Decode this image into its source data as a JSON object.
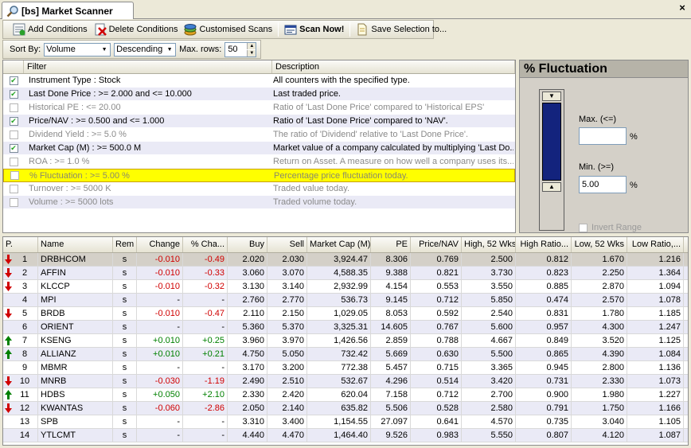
{
  "tab": {
    "title": "[bs] Market Scanner",
    "close": "×"
  },
  "toolbar": {
    "add": "Add Conditions",
    "delete": "Delete Conditions",
    "customised": "Customised Scans",
    "scan": "Scan Now!",
    "save": "Save Selection to..."
  },
  "sortbar": {
    "sort_label": "Sort By:",
    "sort_value": "Volume",
    "order_value": "Descending",
    "maxrows_label": "Max. rows:",
    "maxrows_value": "50"
  },
  "filters": {
    "headers": [
      "Filter",
      "Description"
    ],
    "rows": [
      {
        "checked": true,
        "name": "Instrument Type : Stock",
        "desc": "All counters with the specified type."
      },
      {
        "checked": true,
        "name": "Last Done Price :  >= 2.000  and <= 10.000",
        "desc": "Last traded price."
      },
      {
        "checked": false,
        "name": "Historical PE :  <= 20.00",
        "desc": "Ratio of 'Last Done Price' compared to 'Historical EPS'"
      },
      {
        "checked": true,
        "name": "Price/NAV :  >= 0.500  and <= 1.000",
        "desc": "Ratio of 'Last Done Price' compared to 'NAV'."
      },
      {
        "checked": false,
        "name": "Dividend Yield :  >= 5.0 %",
        "desc": "The ratio of 'Dividend' relative to 'Last Done Price'."
      },
      {
        "checked": true,
        "name": "Market Cap (M) :  >= 500.0 M",
        "desc": "Market value of a company calculated by multiplying 'Last Do..."
      },
      {
        "checked": false,
        "name": "ROA :  >= 1.0 %",
        "desc": "Return on Asset. A measure on how well a company uses its..."
      },
      {
        "checked": false,
        "name": "% Fluctuation :  >= 5.00 %",
        "desc": "Percentage price fluctuation today."
      },
      {
        "checked": false,
        "name": "Turnover :  >= 5000 K",
        "desc": "Traded value today."
      },
      {
        "checked": false,
        "name": "Volume :  >= 5000 lots",
        "desc": "Traded volume today."
      }
    ]
  },
  "fluct_panel": {
    "title": "% Fluctuation",
    "max_label": "Max. (<=)",
    "max_value": "",
    "min_label": "Min. (>=)",
    "min_value": "5.00",
    "unit": "%",
    "invert_label": "Invert Range"
  },
  "grid": {
    "headers": [
      "P.",
      "Name",
      "Rem",
      "Change",
      "% Cha...",
      "Buy",
      "Sell",
      "Market Cap (M)",
      "PE",
      "Price/NAV",
      "High, 52 Wks",
      "High Ratio...",
      "Low, 52 Wks",
      "Low Ratio,..."
    ],
    "rows": [
      {
        "dir": "down",
        "p": "1",
        "name": "DRBHCOM",
        "rem": "s",
        "chg": "-0.010",
        "pct": "-0.49",
        "buy": "2.020",
        "sell": "2.030",
        "mcap": "3,924.47",
        "pe": "8.306",
        "pnav": "0.769",
        "h52": "2.500",
        "hr": "0.812",
        "l52": "1.670",
        "lr": "1.216"
      },
      {
        "dir": "down",
        "p": "2",
        "name": "AFFIN",
        "rem": "s",
        "chg": "-0.010",
        "pct": "-0.33",
        "buy": "3.060",
        "sell": "3.070",
        "mcap": "4,588.35",
        "pe": "9.388",
        "pnav": "0.821",
        "h52": "3.730",
        "hr": "0.823",
        "l52": "2.250",
        "lr": "1.364"
      },
      {
        "dir": "down",
        "p": "3",
        "name": "KLCCP",
        "rem": "s",
        "chg": "-0.010",
        "pct": "-0.32",
        "buy": "3.130",
        "sell": "3.140",
        "mcap": "2,932.99",
        "pe": "4.154",
        "pnav": "0.553",
        "h52": "3.550",
        "hr": "0.885",
        "l52": "2.870",
        "lr": "1.094"
      },
      {
        "dir": "none",
        "p": "4",
        "name": "MPI",
        "rem": "s",
        "chg": "-",
        "pct": "-",
        "buy": "2.760",
        "sell": "2.770",
        "mcap": "536.73",
        "pe": "9.145",
        "pnav": "0.712",
        "h52": "5.850",
        "hr": "0.474",
        "l52": "2.570",
        "lr": "1.078"
      },
      {
        "dir": "down",
        "p": "5",
        "name": "BRDB",
        "rem": "s",
        "chg": "-0.010",
        "pct": "-0.47",
        "buy": "2.110",
        "sell": "2.150",
        "mcap": "1,029.05",
        "pe": "8.053",
        "pnav": "0.592",
        "h52": "2.540",
        "hr": "0.831",
        "l52": "1.780",
        "lr": "1.185"
      },
      {
        "dir": "none",
        "p": "6",
        "name": "ORIENT",
        "rem": "s",
        "chg": "-",
        "pct": "-",
        "buy": "5.360",
        "sell": "5.370",
        "mcap": "3,325.31",
        "pe": "14.605",
        "pnav": "0.767",
        "h52": "5.600",
        "hr": "0.957",
        "l52": "4.300",
        "lr": "1.247"
      },
      {
        "dir": "up",
        "p": "7",
        "name": "KSENG",
        "rem": "s",
        "chg": "+0.010",
        "pct": "+0.25",
        "buy": "3.960",
        "sell": "3.970",
        "mcap": "1,426.56",
        "pe": "2.859",
        "pnav": "0.788",
        "h52": "4.667",
        "hr": "0.849",
        "l52": "3.520",
        "lr": "1.125"
      },
      {
        "dir": "up",
        "p": "8",
        "name": "ALLIANZ",
        "rem": "s",
        "chg": "+0.010",
        "pct": "+0.21",
        "buy": "4.750",
        "sell": "5.050",
        "mcap": "732.42",
        "pe": "5.669",
        "pnav": "0.630",
        "h52": "5.500",
        "hr": "0.865",
        "l52": "4.390",
        "lr": "1.084"
      },
      {
        "dir": "none",
        "p": "9",
        "name": "MBMR",
        "rem": "s",
        "chg": "-",
        "pct": "-",
        "buy": "3.170",
        "sell": "3.200",
        "mcap": "772.38",
        "pe": "5.457",
        "pnav": "0.715",
        "h52": "3.365",
        "hr": "0.945",
        "l52": "2.800",
        "lr": "1.136"
      },
      {
        "dir": "down",
        "p": "10",
        "name": "MNRB",
        "rem": "s",
        "chg": "-0.030",
        "pct": "-1.19",
        "buy": "2.490",
        "sell": "2.510",
        "mcap": "532.67",
        "pe": "4.296",
        "pnav": "0.514",
        "h52": "3.420",
        "hr": "0.731",
        "l52": "2.330",
        "lr": "1.073"
      },
      {
        "dir": "up",
        "p": "11",
        "name": "HDBS",
        "rem": "s",
        "chg": "+0.050",
        "pct": "+2.10",
        "buy": "2.330",
        "sell": "2.420",
        "mcap": "620.04",
        "pe": "7.158",
        "pnav": "0.712",
        "h52": "2.700",
        "hr": "0.900",
        "l52": "1.980",
        "lr": "1.227"
      },
      {
        "dir": "down",
        "p": "12",
        "name": "KWANTAS",
        "rem": "s",
        "chg": "-0.060",
        "pct": "-2.86",
        "buy": "2.050",
        "sell": "2.140",
        "mcap": "635.82",
        "pe": "5.506",
        "pnav": "0.528",
        "h52": "2.580",
        "hr": "0.791",
        "l52": "1.750",
        "lr": "1.166"
      },
      {
        "dir": "none",
        "p": "13",
        "name": "SPB",
        "rem": "s",
        "chg": "-",
        "pct": "-",
        "buy": "3.310",
        "sell": "3.400",
        "mcap": "1,154.55",
        "pe": "27.097",
        "pnav": "0.641",
        "h52": "4.570",
        "hr": "0.735",
        "l52": "3.040",
        "lr": "1.105"
      },
      {
        "dir": "none",
        "p": "14",
        "name": "YTLCMT",
        "rem": "s",
        "chg": "-",
        "pct": "-",
        "buy": "4.440",
        "sell": "4.470",
        "mcap": "1,464.40",
        "pe": "9.526",
        "pnav": "0.983",
        "h52": "5.550",
        "hr": "0.807",
        "l52": "4.120",
        "lr": "1.087"
      }
    ]
  },
  "colors": {
    "down": "#d00000",
    "up": "#008000",
    "selected_row": "#ffff00",
    "alt_row": "#eaeaf6",
    "slider_fill": "#13237d"
  }
}
